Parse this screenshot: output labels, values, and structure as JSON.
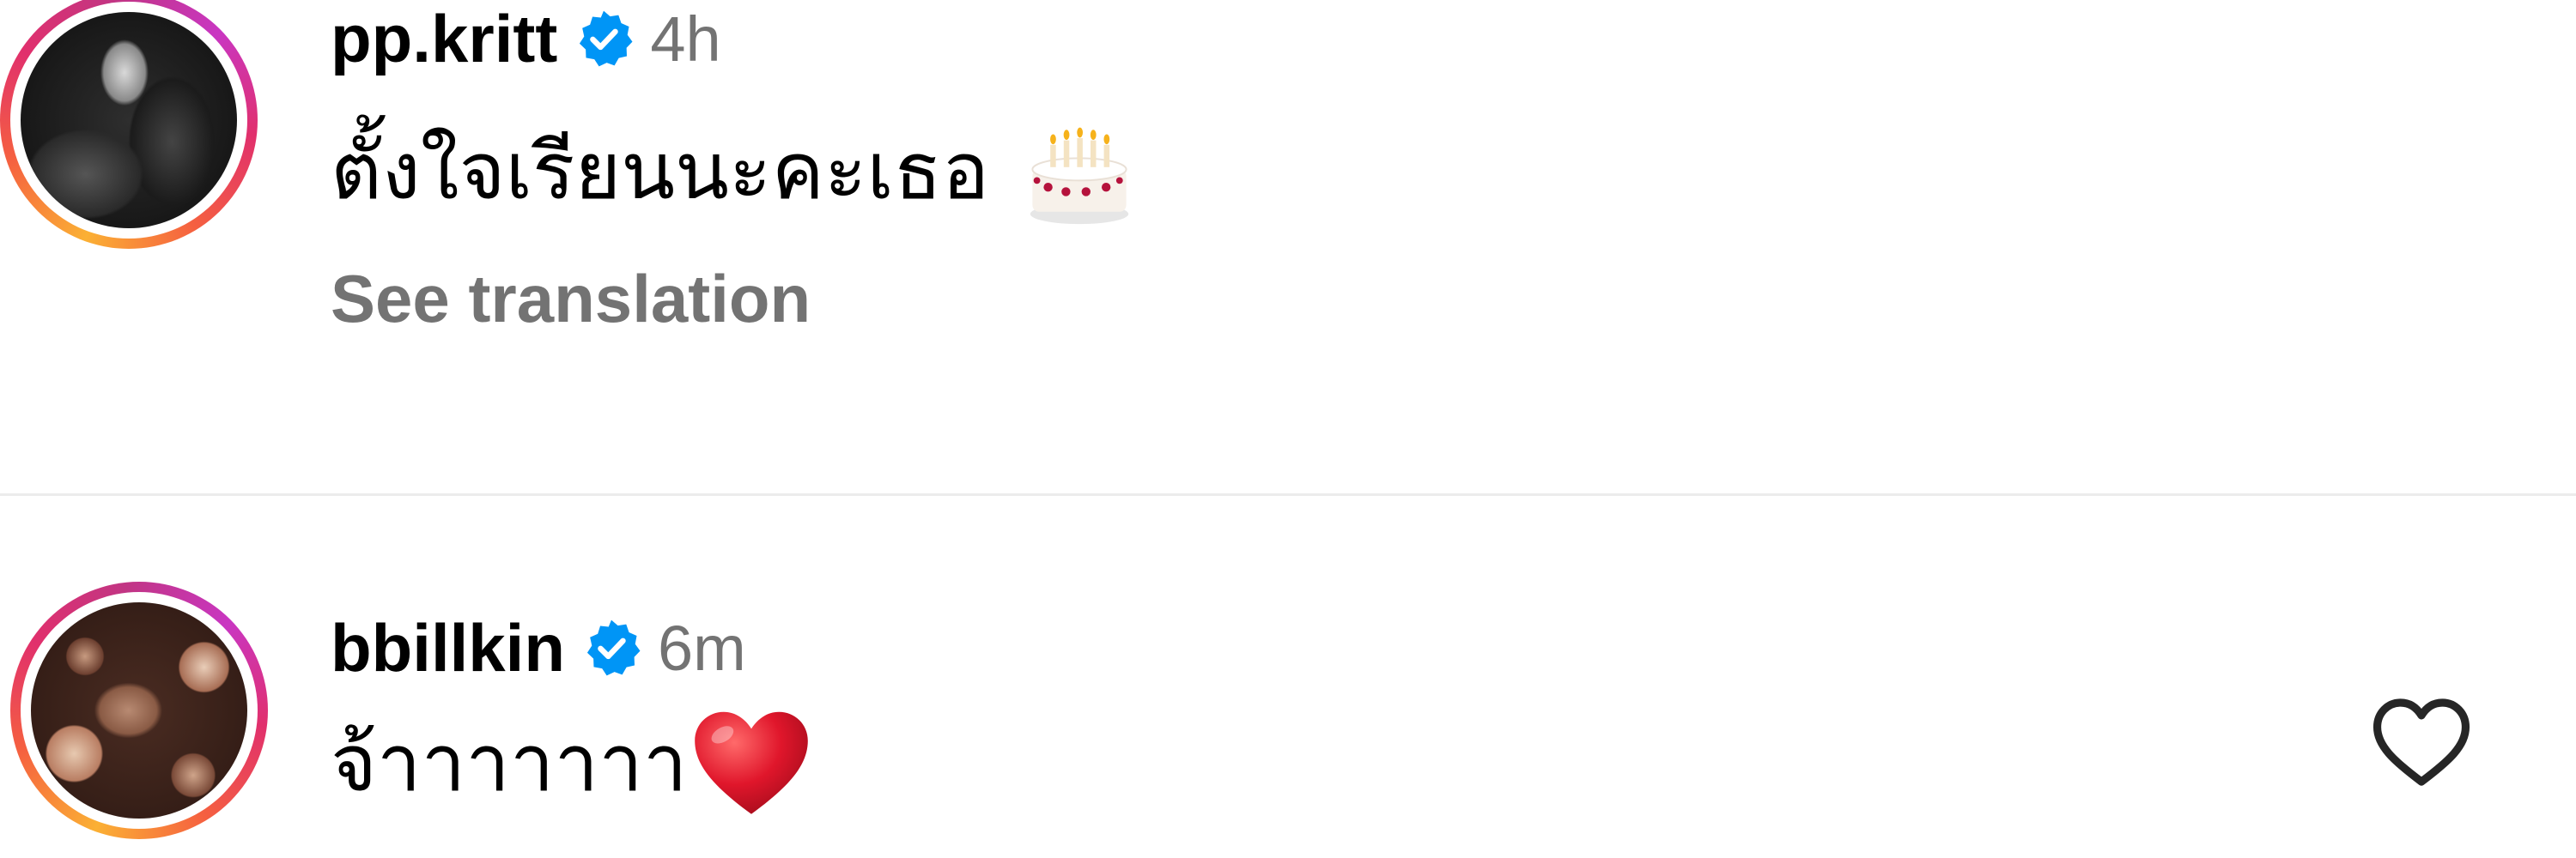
{
  "comments": [
    {
      "username": "pp.kritt",
      "verified": true,
      "time": "4h",
      "text": "ตั้งใจเรียนนะคะเธอ",
      "emoji": "cake-icon",
      "translation_link": "See translation"
    },
    {
      "username": "bbillkin",
      "verified": true,
      "time": "6m",
      "text": "จ้าาาาาาา",
      "emoji": "heart-emoji"
    }
  ],
  "colors": {
    "verified_badge": "#0095f6",
    "muted_text": "#737373",
    "divider": "#ececec",
    "heart_emoji": "#e0162b"
  }
}
